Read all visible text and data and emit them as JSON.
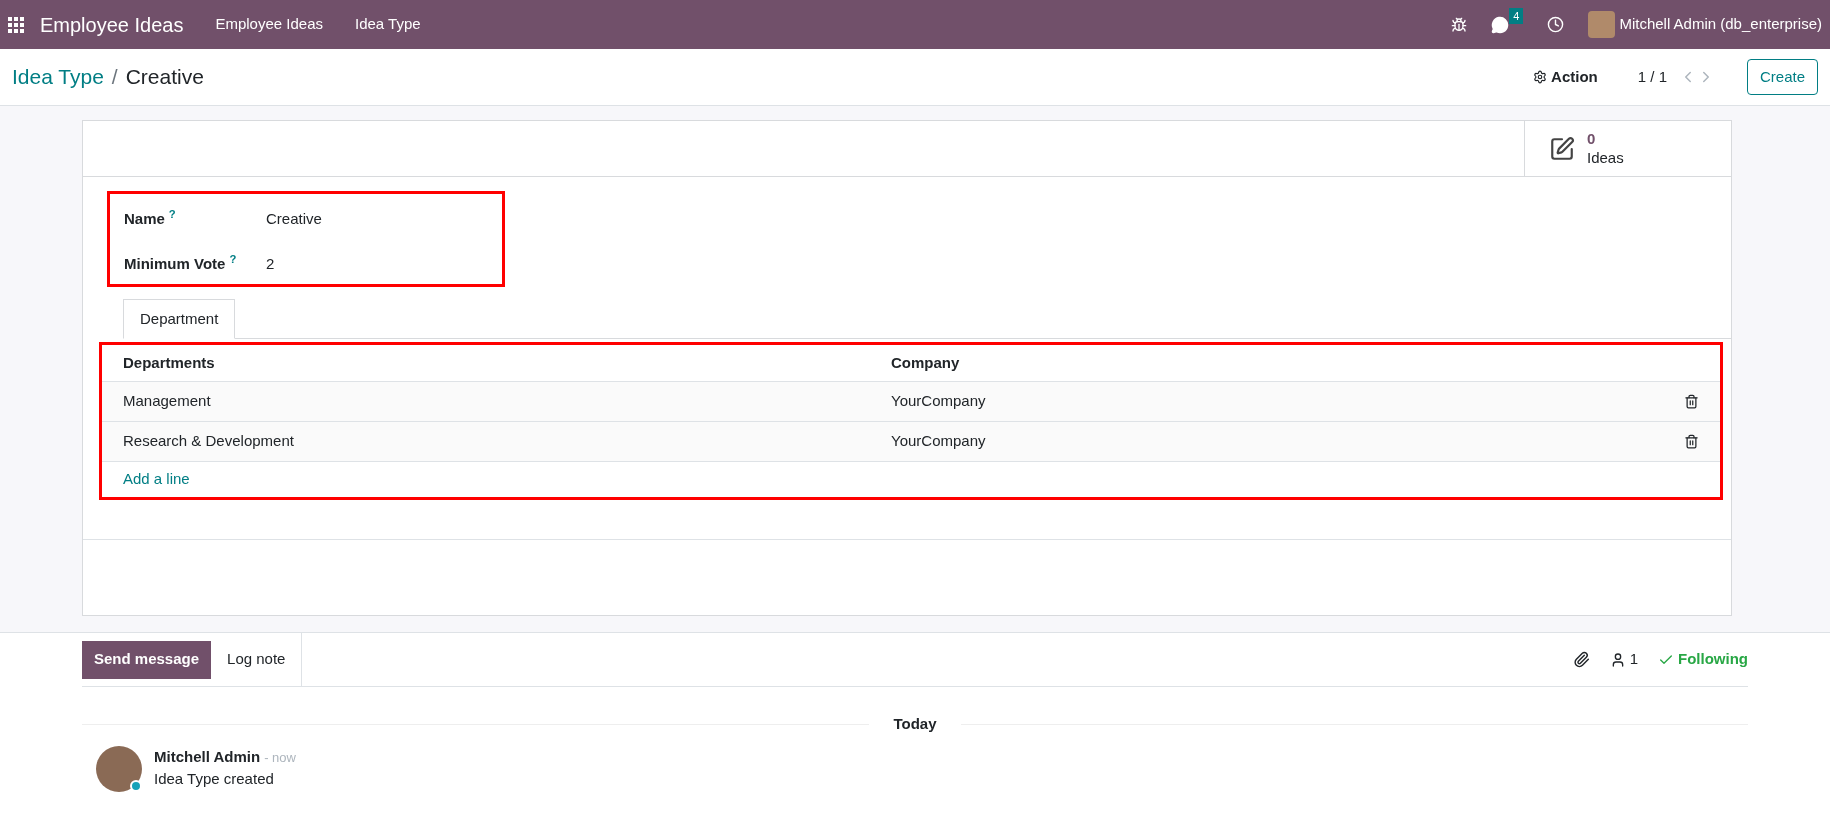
{
  "navbar": {
    "app_title": "Employee Ideas",
    "menu": [
      {
        "label": "Employee Ideas"
      },
      {
        "label": "Idea Type"
      }
    ],
    "message_count": "4",
    "user": "Mitchell Admin (db_enterprise)"
  },
  "control_panel": {
    "breadcrumb": [
      {
        "label": "Idea Type"
      },
      {
        "label": "Creative"
      }
    ],
    "breadcrumb_separator": "/",
    "action": "Action",
    "pager": "1 / 1",
    "create": "Create"
  },
  "smart_button": {
    "count": "0",
    "label": "Ideas"
  },
  "fields": [
    {
      "label": "Name",
      "help": "?",
      "value": "Creative"
    },
    {
      "label": "Minimum Vote",
      "help": "?",
      "value": "2"
    }
  ],
  "tabs": [
    {
      "label": "Department",
      "selected": true
    }
  ],
  "table": {
    "columns": [
      "Departments",
      "Company"
    ],
    "rows": [
      {
        "department": "Management",
        "company": "YourCompany"
      },
      {
        "department": "Research & Development",
        "company": "YourCompany"
      }
    ],
    "add_line": "Add a line"
  },
  "chatter": {
    "send_message": "Send message",
    "log_note": "Log note",
    "followers": "1",
    "following_label": "Following",
    "following": true,
    "date_separator": "Today",
    "messages": [
      {
        "author": "Mitchell Admin",
        "time": "- now",
        "body": "Idea Type created",
        "online": true
      }
    ]
  }
}
